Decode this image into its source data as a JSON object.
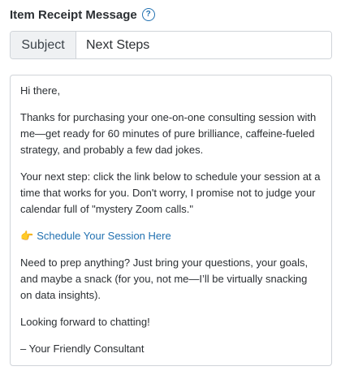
{
  "header": {
    "title": "Item Receipt Message",
    "help_icon_glyph": "?"
  },
  "subject": {
    "label": "Subject",
    "value": "Next Steps"
  },
  "message": {
    "greeting": "Hi there,",
    "paragraph1": "Thanks for purchasing your one-on-one consulting session with me—get ready for 60 minutes of pure brilliance, caffeine-fueled strategy, and probably a few dad jokes.",
    "paragraph2": "Your next step: click the link below to schedule your session at a time that works for you. Don't worry, I promise not to judge your calendar full of \"mystery Zoom calls.\"",
    "link_icon": "👉",
    "link_text": "Schedule Your Session Here",
    "paragraph3": "Need to prep anything? Just bring your questions, your goals, and maybe a snack (for you, not me—I’ll be virtually snacking on data insights).",
    "paragraph4": "Looking forward to chatting!",
    "signature": "– Your Friendly Consultant"
  },
  "colors": {
    "accent": "#2271b1",
    "border": "#d0d4d9",
    "label_bg": "#eff1f3"
  }
}
